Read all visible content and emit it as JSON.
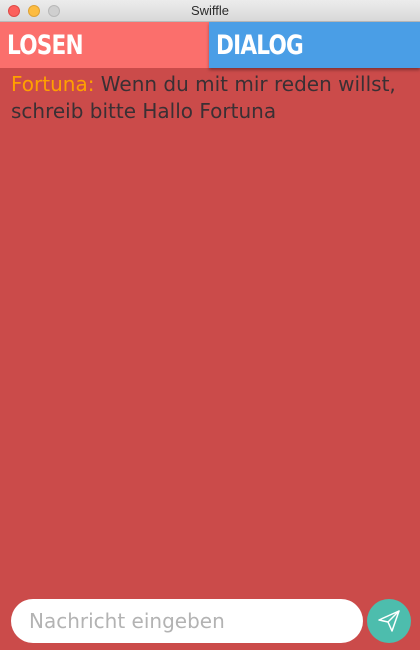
{
  "window": {
    "title": "Swiffle"
  },
  "tabs": [
    {
      "label": "Losen",
      "color": "#fb6f6c"
    },
    {
      "label": "Dialog",
      "color": "#4a9ee6",
      "active": true
    }
  ],
  "chat": {
    "background": "#cb4b4a",
    "messages": [
      {
        "sender": "Fortuna:",
        "text": "Wenn du mit mir reden willst, schreib bitte Hallo Fortuna",
        "sender_color": "#ffa000"
      }
    ]
  },
  "composer": {
    "placeholder": "Nachricht eingeben",
    "value": "",
    "send_icon": "paper-plane-icon",
    "send_color": "#4dbdad"
  }
}
